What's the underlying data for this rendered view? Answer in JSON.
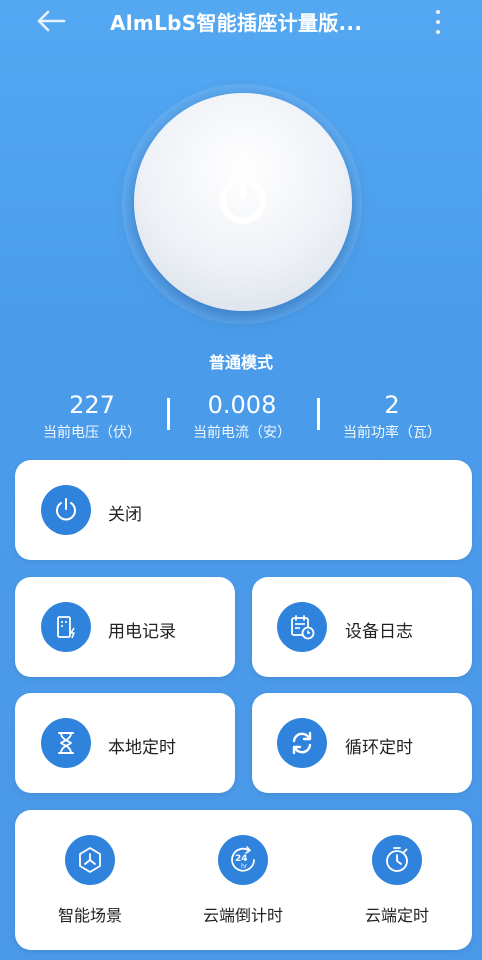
{
  "header": {
    "title": "AlmLbS智能插座计量版...",
    "back_icon": "arrow-left-icon",
    "more_icon": "more-vertical-icon"
  },
  "power": {
    "icon": "power-icon",
    "mode": "普通模式"
  },
  "stats": [
    {
      "value": "227",
      "label": "当前电压（伏）"
    },
    {
      "value": "0.008",
      "label": "当前电流（安）"
    },
    {
      "value": "2",
      "label": "当前功率（瓦）"
    }
  ],
  "switch_card": {
    "label": "关闭",
    "icon": "power-icon"
  },
  "grid": [
    {
      "label": "用电记录",
      "icon": "usage-record-icon"
    },
    {
      "label": "设备日志",
      "icon": "calendar-log-icon"
    },
    {
      "label": "本地定时",
      "icon": "hourglass-icon"
    },
    {
      "label": "循环定时",
      "icon": "cycle-arrows-icon"
    }
  ],
  "bottom": [
    {
      "label": "智能场景",
      "icon": "scene-icon"
    },
    {
      "label": "云端倒计时",
      "icon": "countdown-24hr-icon"
    },
    {
      "label": "云端定时",
      "icon": "stopwatch-icon"
    }
  ],
  "colors": {
    "background": "#4a9cea",
    "accent": "#2f83dc",
    "card": "#ffffff"
  }
}
